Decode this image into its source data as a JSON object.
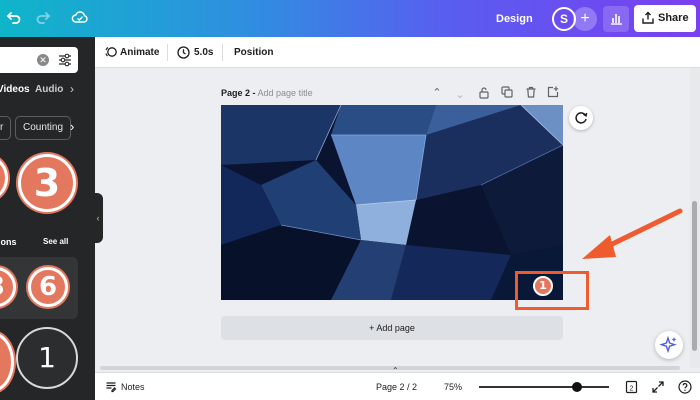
{
  "topbar": {
    "undo_icon": "undo-icon",
    "redo_icon": "redo-icon",
    "cloud_icon": "cloud-sync-icon",
    "design_label": "Design",
    "avatar_initial": "S",
    "share_label": "Share",
    "gradient": [
      "#0fb5c9",
      "#7a3ff0"
    ]
  },
  "left_panel": {
    "tabs": [
      {
        "label": "Videos",
        "active": true
      },
      {
        "label": "Audio",
        "active": false
      }
    ],
    "chips": [
      "r",
      "Counting"
    ],
    "numbers_top": [
      "3"
    ],
    "section_title": "ions",
    "see_all": "See all",
    "numbers_section": [
      "3",
      "6"
    ],
    "numbers_bottom": [
      "1"
    ]
  },
  "toolbar": {
    "animate_label": "Animate",
    "duration_label": "5.0s",
    "position_label": "Position"
  },
  "page": {
    "label": "Page 2 -",
    "title_placeholder": "Add page title",
    "add_page_label": "+ Add page"
  },
  "annotation": {
    "badge": "1",
    "color": "#ef5b2e"
  },
  "footer": {
    "notes_label": "Notes",
    "page_indicator": "Page 2 / 2",
    "zoom_label": "75%",
    "zoom_level": 0.75,
    "pages_count": "2"
  }
}
